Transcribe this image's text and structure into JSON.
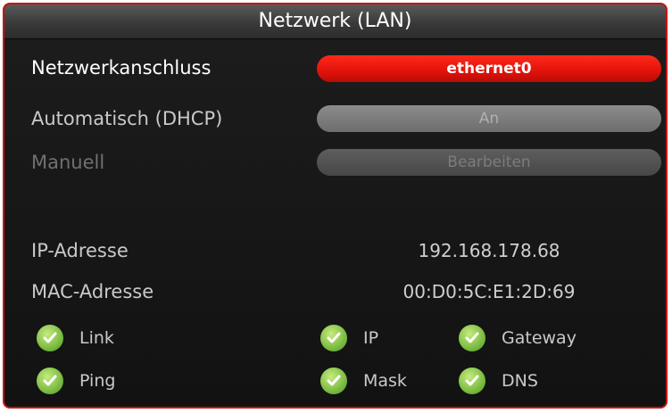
{
  "window": {
    "title": "Netzwerk (LAN)",
    "border_color": "#c81414"
  },
  "settings": [
    {
      "label": "Netzwerkanschluss",
      "value": "ethernet0",
      "state": "selected"
    },
    {
      "label": "Automatisch (DHCP)",
      "value": "An",
      "state": "normal"
    },
    {
      "label": "Manuell",
      "value": "Bearbeiten",
      "state": "disabled"
    }
  ],
  "info": {
    "ip_label": "IP-Adresse",
    "ip_value": "192.168.178.68",
    "mac_label": "MAC-Adresse",
    "mac_value": "00:D0:5C:E1:2D:69"
  },
  "status": {
    "icon": "check-icon",
    "ok_color": "#7cc242",
    "items": [
      {
        "label": "Link",
        "ok": true
      },
      {
        "label": "IP",
        "ok": true
      },
      {
        "label": "Gateway",
        "ok": true
      },
      {
        "label": "Ping",
        "ok": true
      },
      {
        "label": "Mask",
        "ok": true
      },
      {
        "label": "DNS",
        "ok": true
      }
    ]
  }
}
